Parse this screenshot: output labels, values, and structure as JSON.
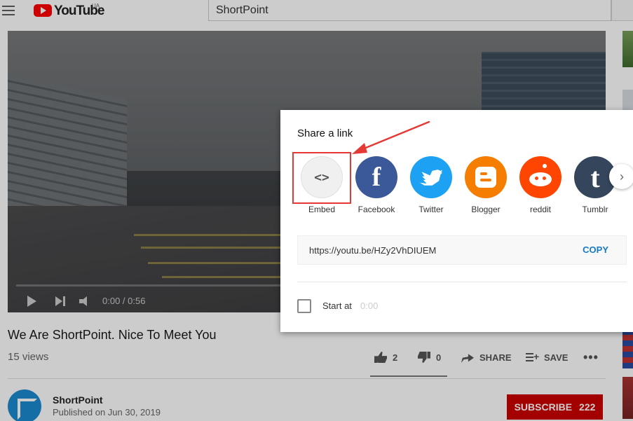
{
  "header": {
    "logo_text": "YouTube",
    "region": "UA",
    "search_value": "ShortPoint"
  },
  "player": {
    "time": "0:00 / 0:56"
  },
  "video": {
    "title": "We Are ShortPoint. Nice To Meet You",
    "views": "15 views",
    "likes": "2",
    "dislikes": "0",
    "share_label": "SHARE",
    "save_label": "SAVE",
    "more_label": "•••"
  },
  "channel": {
    "name": "ShortPoint",
    "published": "Published on Jun 30, 2019",
    "subscribe_label": "SUBSCRIBE",
    "subscriber_count": "222"
  },
  "share_dialog": {
    "title": "Share a link",
    "targets": [
      {
        "label": "Embed",
        "glyph": "<>",
        "color": "#f0f0f0"
      },
      {
        "label": "Facebook",
        "glyph": "f",
        "color": "#3b5998"
      },
      {
        "label": "Twitter",
        "glyph": "",
        "color": "#1da1f2"
      },
      {
        "label": "Blogger",
        "glyph": "",
        "color": "#f57d00"
      },
      {
        "label": "reddit",
        "glyph": "",
        "color": "#ff4500"
      },
      {
        "label": "Tumblr",
        "glyph": "t",
        "color": "#35465c"
      }
    ],
    "next_glyph": "›",
    "url": "https://youtu.be/HZy2VhDIUEM",
    "copy_label": "COPY",
    "start_at_label": "Start at",
    "start_at_value": "0:00"
  },
  "annotation": {
    "color": "#e53935"
  }
}
